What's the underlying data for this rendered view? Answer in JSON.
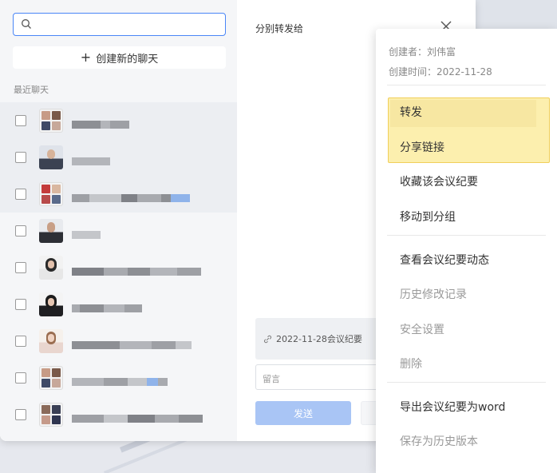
{
  "search": {
    "placeholder": ""
  },
  "new_chat_button": {
    "label": "创建新的聊天"
  },
  "section_label": "最近聊天",
  "chats": [
    {
      "avatar": "group-grid",
      "name_blur": [
        36,
        12,
        24
      ]
    },
    {
      "avatar": "man-suit",
      "name_blur": [
        48
      ]
    },
    {
      "avatar": "group-red",
      "name_blur": [
        22,
        40,
        20,
        30,
        12,
        24
      ]
    },
    {
      "avatar": "man-dark",
      "name_blur": [
        36
      ]
    },
    {
      "avatar": "woman-white",
      "name_blur": [
        40,
        30,
        28,
        34,
        30
      ]
    },
    {
      "avatar": "woman-dark",
      "name_blur": [
        10,
        30,
        26,
        22
      ]
    },
    {
      "avatar": "woman-light",
      "name_blur": [
        60,
        40,
        30,
        20
      ]
    },
    {
      "avatar": "group-grid",
      "name_blur": [
        40,
        30,
        24,
        14,
        12
      ]
    },
    {
      "avatar": "group-grid2",
      "name_blur": [
        40,
        30,
        34,
        30,
        30
      ]
    }
  ],
  "forward_panel": {
    "title": "分别转发给",
    "attachment": "2022-11-28会议纪要",
    "message_placeholder": "留言",
    "send_label": "发送"
  },
  "menu": {
    "creator": "创建者：刘伟富",
    "created_time": "创建时间：2022-11-28",
    "items": [
      {
        "label": "转发",
        "enabled": true
      },
      {
        "label": "分享链接",
        "enabled": true
      },
      {
        "label": "收藏该会议纪要",
        "enabled": true
      },
      {
        "label": "移动到分组",
        "enabled": true
      },
      {
        "label": "查看会议纪要动态",
        "enabled": true
      },
      {
        "label": "历史修改记录",
        "enabled": false
      },
      {
        "label": "安全设置",
        "enabled": false
      },
      {
        "label": "删除",
        "enabled": false
      },
      {
        "label": "导出会议纪要为word",
        "enabled": true
      },
      {
        "label": "保存为历史版本",
        "enabled": false
      }
    ]
  },
  "colors": {
    "accent": "#4a86f7",
    "send_button": "#a9c5f5",
    "highlight_fill": "#fcefae",
    "highlight_border": "#f0cf5a"
  }
}
